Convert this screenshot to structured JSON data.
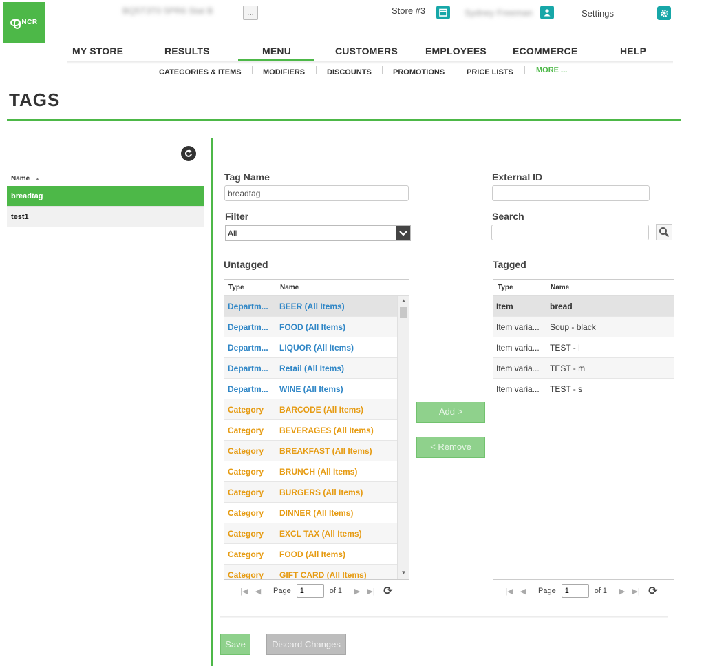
{
  "header": {
    "logo_text": "NCR",
    "store_name_blurred": "BQ5T3T0 5PR6 Stat B",
    "more_button": "...",
    "store_label": "Store #3",
    "user_name_blurred": "Sydney Freeman",
    "settings_label": "Settings"
  },
  "main_nav": [
    {
      "label": "MY STORE"
    },
    {
      "label": "RESULTS"
    },
    {
      "label": "MENU",
      "active": true
    },
    {
      "label": "CUSTOMERS"
    },
    {
      "label": "EMPLOYEES"
    },
    {
      "label": "ECOMMERCE"
    },
    {
      "label": "HELP"
    }
  ],
  "sub_nav": [
    {
      "label": "CATEGORIES & ITEMS"
    },
    {
      "label": "MODIFIERS"
    },
    {
      "label": "DISCOUNTS"
    },
    {
      "label": "PROMOTIONS"
    },
    {
      "label": "PRICE LISTS"
    },
    {
      "label": "MORE ..."
    }
  ],
  "page_title": "TAGS",
  "tag_list": {
    "column": "Name",
    "sort_indicator": "▲",
    "items": [
      {
        "name": "breadtag",
        "selected": true
      },
      {
        "name": "test1",
        "selected": false
      }
    ]
  },
  "form": {
    "tag_name_label": "Tag Name",
    "tag_name_value": "breadtag",
    "external_id_label": "External ID",
    "external_id_value": "",
    "filter_label": "Filter",
    "filter_value": "All",
    "search_label": "Search",
    "search_value": ""
  },
  "untagged": {
    "title": "Untagged",
    "col_type": "Type",
    "col_name": "Name",
    "rows": [
      {
        "type": "Departm...",
        "name": "BEER (All Items)",
        "kind": "dept"
      },
      {
        "type": "Departm...",
        "name": "FOOD (All Items)",
        "kind": "dept"
      },
      {
        "type": "Departm...",
        "name": "LIQUOR (All Items)",
        "kind": "dept"
      },
      {
        "type": "Departm...",
        "name": "Retail (All Items)",
        "kind": "dept"
      },
      {
        "type": "Departm...",
        "name": "WINE (All Items)",
        "kind": "dept"
      },
      {
        "type": "Category",
        "name": "BARCODE (All Items)",
        "kind": "cat"
      },
      {
        "type": "Category",
        "name": "BEVERAGES (All Items)",
        "kind": "cat"
      },
      {
        "type": "Category",
        "name": "BREAKFAST (All Items)",
        "kind": "cat"
      },
      {
        "type": "Category",
        "name": "BRUNCH (All Items)",
        "kind": "cat"
      },
      {
        "type": "Category",
        "name": "BURGERS (All Items)",
        "kind": "cat"
      },
      {
        "type": "Category",
        "name": "DINNER (All Items)",
        "kind": "cat"
      },
      {
        "type": "Category",
        "name": "EXCL TAX (All Items)",
        "kind": "cat"
      },
      {
        "type": "Category",
        "name": "FOOD (All Items)",
        "kind": "cat"
      },
      {
        "type": "Category",
        "name": "GIFT CARD (All Items)",
        "kind": "cat"
      }
    ],
    "pager": {
      "page_label": "Page",
      "page_value": "1",
      "of_label": "of 1"
    }
  },
  "tagged": {
    "title": "Tagged",
    "col_type": "Type",
    "col_name": "Name",
    "rows": [
      {
        "type": "Item",
        "name": "bread",
        "bold": true
      },
      {
        "type": "Item varia...",
        "name": "Soup - black"
      },
      {
        "type": "Item varia...",
        "name": "TEST - l"
      },
      {
        "type": "Item varia...",
        "name": "TEST - m"
      },
      {
        "type": "Item varia...",
        "name": "TEST - s"
      }
    ],
    "pager": {
      "page_label": "Page",
      "page_value": "1",
      "of_label": "of 1"
    }
  },
  "buttons": {
    "add": "Add >",
    "remove": "< Remove",
    "save": "Save",
    "discard": "Discard Changes"
  },
  "colors": {
    "brand_green": "#4db848",
    "teal": "#17a7a8",
    "department_blue": "#2f86c6",
    "category_orange": "#e69b12"
  }
}
